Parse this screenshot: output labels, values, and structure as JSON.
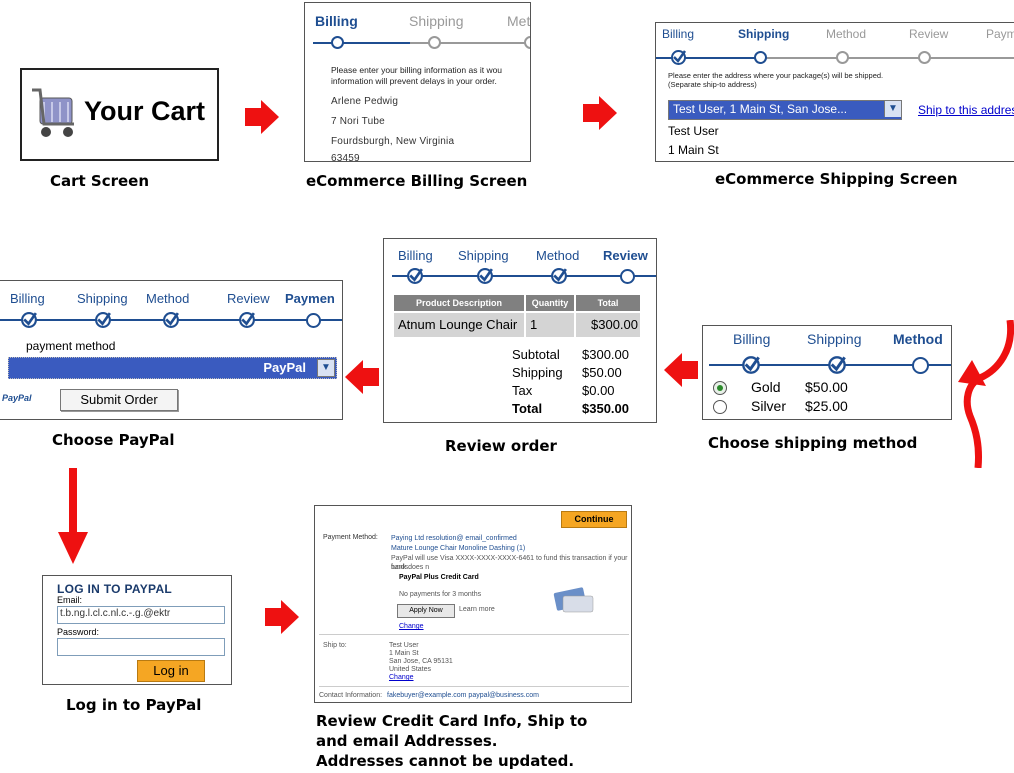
{
  "colors": {
    "accent": "#1f4e91",
    "arrow": "#ee1111",
    "check_gray": "#808080",
    "highlight": "#3a5bbf",
    "button_orange": "#f5a623"
  },
  "captions": {
    "cart": "Cart Screen",
    "billing": "eCommerce Billing Screen",
    "shipping": "eCommerce Shipping Screen",
    "paypal": "Choose PayPal",
    "review": "Review order",
    "method": "Choose shipping method",
    "login": "Log in to PayPal",
    "review_cc": [
      "Review Credit Card Info, Ship to",
      "and email Addresses.",
      "Addresses cannot be updated."
    ]
  },
  "cart": {
    "title": "Your Cart",
    "icon": "shopping-cart-icon"
  },
  "billing": {
    "steps": [
      "Billing",
      "Shipping",
      "Met"
    ],
    "intro": [
      "Please enter your billing information as it wou",
      "information will prevent delays in your order."
    ],
    "lines": [
      "Arlene Pedwig",
      "7 Nori Tube",
      "Fourdsburgh, New Virginia",
      "63459"
    ]
  },
  "shipping": {
    "steps": [
      "Billing",
      "Shipping",
      "Method",
      "Review",
      "Paym"
    ],
    "intro": [
      "Please enter the address where your package(s) will be shipped.",
      "(Separate ship-to address)"
    ],
    "select_value": "Test User, 1 Main St, San Jose...",
    "link": "Ship to this addres",
    "lines": [
      "Test User",
      "1 Main St"
    ]
  },
  "paypal": {
    "steps": [
      "Billing",
      "Shipping",
      "Method",
      "Review",
      "Paymen"
    ],
    "label": "payment method",
    "select_value": "PayPal",
    "logo": "PayPal",
    "button": "Submit Order"
  },
  "review": {
    "steps": [
      "Billing",
      "Shipping",
      "Method",
      "Review"
    ],
    "headers": [
      "Product Description",
      "Quantity",
      "Total"
    ],
    "row": [
      "Atnum Lounge Chair",
      "1",
      "$300.00"
    ],
    "totals": [
      {
        "label": "Subtotal",
        "value": "$300.00"
      },
      {
        "label": "Shipping",
        "value": "$50.00"
      },
      {
        "label": "Tax",
        "value": "$0.00"
      },
      {
        "label": "Total",
        "value": "$350.00"
      }
    ]
  },
  "method": {
    "steps": [
      "Billing",
      "Shipping",
      "Method"
    ],
    "options": [
      {
        "label": "Gold",
        "price": "$50.00",
        "selected": true
      },
      {
        "label": "Silver",
        "price": "$25.00",
        "selected": false
      }
    ]
  },
  "login": {
    "title": "LOG IN TO PAYPAL",
    "email_label": "Email:",
    "email_value": "t.b.ng.l.cl.c.nl.c.-.g.@ektr",
    "password_label": "Password:",
    "button": "Log in"
  },
  "review_cc": {
    "continue": "Continue",
    "payment_label": "Payment Method:",
    "payment_lines": [
      "Mature Lounge Chair Monoline Dashing (1)",
      "PayPal will use Visa XXXX-XXXX-XXXX-6461 to fund this transaction if your bank does n",
      "funds."
    ],
    "payment_head": "Paying Ltd resolution@ email_confirmed",
    "credit_title": "PayPal Plus Credit Card",
    "credit_sub": "No payments for 3 months",
    "apply": "Apply Now",
    "learn": "Learn more",
    "change": "Change",
    "ship_label": "Ship to:",
    "ship_lines": [
      "Test User",
      "1 Main St",
      "San Jose, CA 95131",
      "United States"
    ],
    "ship_change": "Change",
    "contact_label": "Contact Information:",
    "contact_value": "fakebuyer@example.com  paypal@business.com"
  }
}
